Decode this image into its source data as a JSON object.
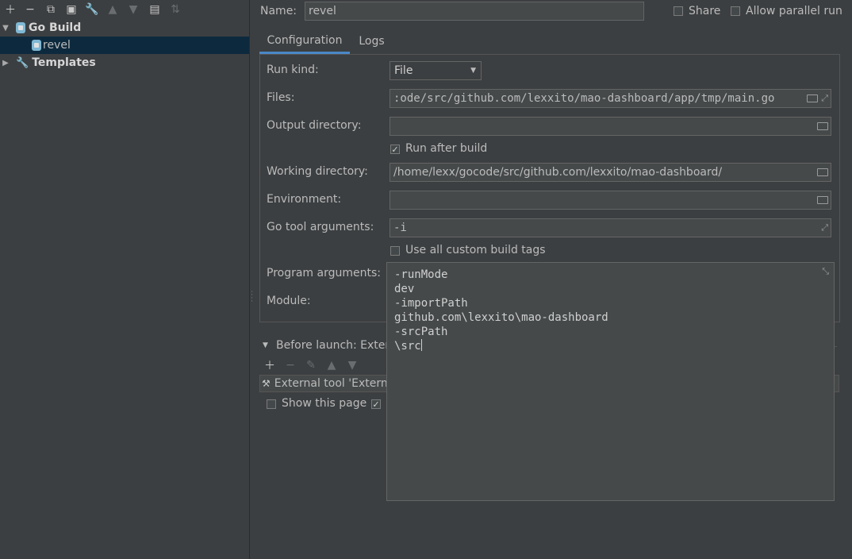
{
  "toolbar": {
    "icons": [
      "plus-icon",
      "minus-icon",
      "copy-icon",
      "save-icon",
      "wrench-icon",
      "arrow-up-icon",
      "arrow-down-icon",
      "folder-add-icon",
      "sort-icon"
    ]
  },
  "tree": {
    "go_build": "Go Build",
    "revel": "revel",
    "templates": "Templates"
  },
  "header": {
    "name_label": "Name:",
    "name_value": "revel",
    "share_label": "Share",
    "allow_parallel_label": "Allow parallel run"
  },
  "tabs": {
    "configuration": "Configuration",
    "logs": "Logs"
  },
  "form": {
    "run_kind_label": "Run kind:",
    "run_kind_value": "File",
    "files_label": "Files:",
    "files_value": ":ode/src/github.com/lexxito/mao-dashboard/app/tmp/main.go",
    "output_dir_label": "Output directory:",
    "output_dir_value": "",
    "run_after_build_label": "Run after build",
    "working_dir_label": "Working directory:",
    "working_dir_value": "/home/lexx/gocode/src/github.com/lexxito/mao-dashboard/",
    "environment_label": "Environment:",
    "environment_value": "",
    "go_tool_args_label": "Go tool arguments:",
    "go_tool_args_value": "-i",
    "custom_build_tags_label": "Use all custom build tags",
    "program_args_label": "Program arguments:",
    "module_label": "Module:"
  },
  "program_args_popup": {
    "lines": [
      "-runMode",
      "dev",
      "-importPath",
      "github.com\\lexxito\\mao-dashboard",
      "-srcPath",
      "\\src"
    ]
  },
  "before_launch": {
    "title": "Before launch: Externa",
    "task": "External tool 'Extern",
    "show_page_label": "Show this page"
  }
}
